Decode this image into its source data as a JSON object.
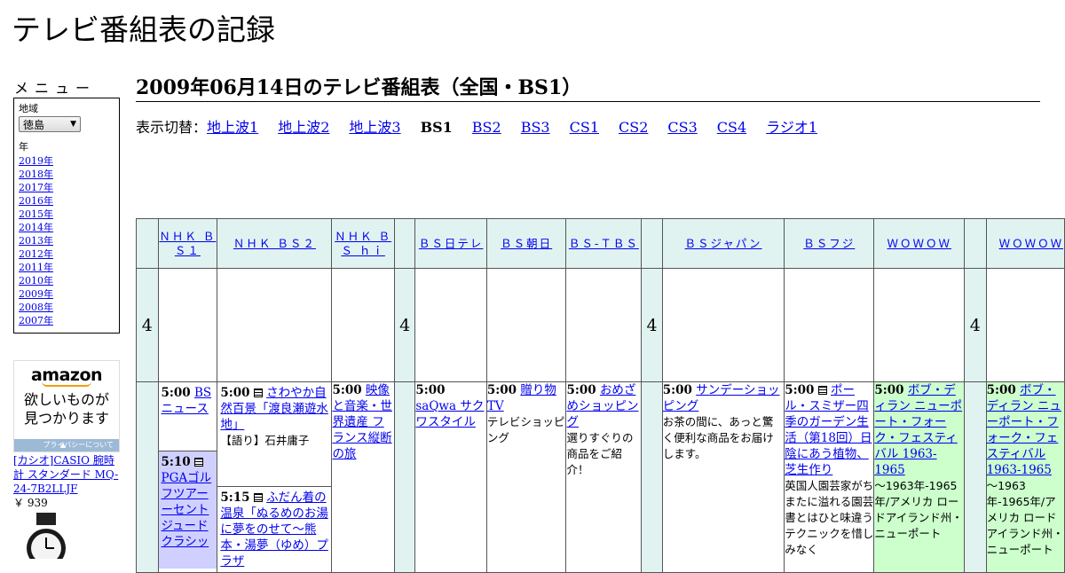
{
  "site": {
    "title": "テレビ番組表の記録"
  },
  "sidebar": {
    "menu_label": "メニュー",
    "region_label": "地域",
    "region_value": "徳島",
    "year_label": "年",
    "years": [
      "2019年",
      "2018年",
      "2017年",
      "2016年",
      "2015年",
      "2014年",
      "2013年",
      "2012年",
      "2011年",
      "2010年",
      "2009年",
      "2008年",
      "2007年"
    ]
  },
  "ad": {
    "logo": "amazon",
    "catch_line1": "欲しいものが",
    "catch_line2": "見つかります",
    "privacy": "プライバシーについて",
    "product": "[カシオ]CASIO 腕時計 スタンダード MQ-24-7B2LLJF",
    "price": "￥ 939"
  },
  "main": {
    "heading": "2009年06月14日のテレビ番組表（全国・BS1）",
    "switch_label": "表示切替：",
    "switch_items": [
      {
        "label": "地上波1",
        "current": false
      },
      {
        "label": "地上波2",
        "current": false
      },
      {
        "label": "地上波3",
        "current": false
      },
      {
        "label": "BS1",
        "current": true
      },
      {
        "label": "BS2",
        "current": false
      },
      {
        "label": "BS3",
        "current": false
      },
      {
        "label": "CS1",
        "current": false
      },
      {
        "label": "CS2",
        "current": false
      },
      {
        "label": "CS3",
        "current": false
      },
      {
        "label": "CS4",
        "current": false
      },
      {
        "label": "ラジオ1",
        "current": false
      }
    ]
  },
  "grid": {
    "hour": "4",
    "channels": [
      "ＮＨＫ ＢＳ１",
      "ＮＨＫ ＢＳ２",
      "ＮＨＫ ＢＳ ｈｉ",
      "ＢＳ日テレ",
      "ＢＳ朝日",
      "ＢＳ-ＴＢＳ",
      "ＢＳジャパン",
      "ＢＳフジ",
      "ＷＯＷＯＷ",
      "ＷＯＷＯＷ"
    ],
    "programs": {
      "bs1_a": {
        "time": "5:00",
        "title": "BSニュース"
      },
      "bs1_b": {
        "time": "5:10",
        "title": "PGAゴルフツアー ーセントジュード クラシッ"
      },
      "bs2_a": {
        "time": "5:00",
        "title": "さわやか自然百景「渡良瀬遊水地」",
        "desc": "【語り】石井庸子"
      },
      "bs2_b": {
        "time": "5:15",
        "title": "ふだん着の温泉「ぬるめのお湯に夢をのせて～熊本・湯夢（ゆめ）プラザ"
      },
      "bshi": {
        "time": "5:00",
        "title": "映像と音楽・世界遺産 フランス縦断の旅"
      },
      "bsntv": {
        "time": "5:00",
        "title": "saQwa サクワスタイル"
      },
      "bsasahi": {
        "time": "5:00",
        "title": "贈り物TV",
        "desc": "テレビショッピング"
      },
      "bstbs": {
        "time": "5:00",
        "title": "おめざめショッピング",
        "desc": "選りすぐりの商品をご紹介！"
      },
      "bsjapan": {
        "time": "5:00",
        "title": "サンデーショッピング",
        "desc": "お茶の間に、あっと驚く便利な商品をお届けします。"
      },
      "bsfuji": {
        "time": "5:00",
        "title": "ポール・スミザー四季のガーデン生活（第18回）日陰にあう植物、芝生作り",
        "desc": "英国人園芸家がちまたに溢れる園芸書とはひと味違うテクニックを惜しみなく"
      },
      "wowow1": {
        "time": "5:00",
        "title": "ボブ・ディラン ニューポート・フォーク・フェスティバル 1963-1965",
        "desc": "～1963年-1965年/アメリカ ロードアイランド州・ニューポート"
      },
      "wowow2": {
        "time": "5:00",
        "title": "ボブ・ディラン ニューポート・フォーク・フェスティバル 1963-1965",
        "desc": "～1963年-1965年/アメリカ ロードアイランド州・ニューポート"
      }
    }
  },
  "colors": {
    "link": "#0000ee",
    "header_bg": "#e0f3f1",
    "bs1_highlight": "#cfd0ff",
    "wowow_highlight": "#ccffcc"
  }
}
